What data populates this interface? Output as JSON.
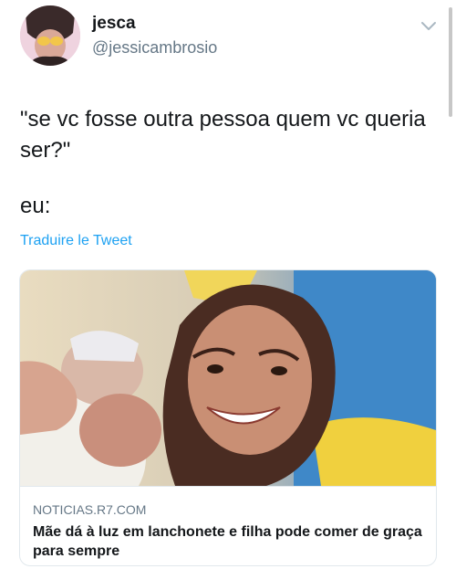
{
  "tweet": {
    "author": {
      "display_name": "jesca",
      "handle": "@jessicambrosio"
    },
    "text_line1": "\"se vc fosse outra pessoa quem vc queria ser?\"",
    "text_line2": "eu:",
    "translate_label": "Traduire le Tweet",
    "menu_icon": "chevron-down-icon"
  },
  "link_card": {
    "domain": "NOTICIAS.R7.COM",
    "title": "Mãe dá à luz em lanchonete e filha pode comer de graça para sempre"
  },
  "colors": {
    "link": "#1da1f2",
    "secondary_text": "#657786",
    "primary_text": "#14171a",
    "border": "#e1e8ed"
  }
}
